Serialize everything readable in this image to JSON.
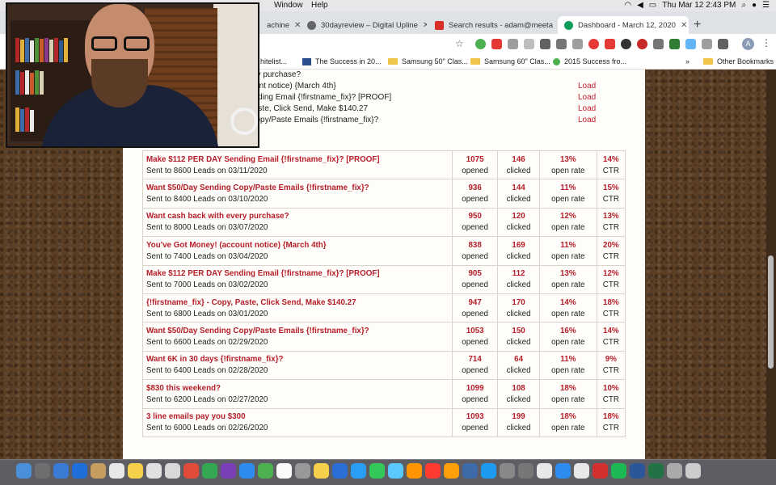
{
  "menubar": {
    "window_menu": "Window",
    "help_menu": "Help",
    "clock": "Thu Mar 12  2:43 PM"
  },
  "tabs": [
    {
      "label": "achine",
      "favicon_color": "#888888",
      "active": false
    },
    {
      "label": "30dayreview – Digital Upline",
      "favicon_color": "#666666",
      "active": false
    },
    {
      "label": "Search results - adam@meeta",
      "favicon_color": "#d93025",
      "active": false
    },
    {
      "label": "Dashboard - March 12, 2020",
      "favicon_color": "#0f9d58",
      "active": true
    }
  ],
  "bookmarks": [
    {
      "label": "hitelist...",
      "kind": "text"
    },
    {
      "label": "The Success in 20...",
      "kind": "square"
    },
    {
      "label": "Samsung 50\" Clas...",
      "kind": "folder"
    },
    {
      "label": "Samsung 60\" Clas...",
      "kind": "folder"
    },
    {
      "label": "2015 Success fro...",
      "kind": "circle"
    },
    {
      "label": "»",
      "kind": "text"
    },
    {
      "label": "Other Bookmarks",
      "kind": "folder"
    }
  ],
  "upper_list": [
    {
      "subject": "Want cash back with every purchase?",
      "action": ""
    },
    {
      "subject": "You've Got Money! (account notice) {March 4th}",
      "action": "Load"
    },
    {
      "subject": "Make $112 PER DAY Sending Email {!firstname_fix}? [PROOF]",
      "action": "Load"
    },
    {
      "subject": "{!firstname_fix} - Copy, Paste, Click Send, Make $140.27",
      "action": "Load"
    },
    {
      "subject": "Want $50/Day Sending Copy/Paste Emails {!firstname_fix}?",
      "action": "Load"
    }
  ],
  "stats_labels": {
    "opened": "opened",
    "clicked": "clicked",
    "open_rate": "open rate",
    "ctr": "CTR"
  },
  "campaigns": [
    {
      "subject": "Make $112 PER DAY Sending Email {!firstname_fix}? [PROOF]",
      "sent": "Sent to 8600 Leads on 03/11/2020",
      "opened": "1075",
      "clicked": "146",
      "open_rate": "13%",
      "ctr": "14%"
    },
    {
      "subject": "Want $50/Day Sending Copy/Paste Emails {!firstname_fix}?",
      "sent": "Sent to 8400 Leads on 03/10/2020",
      "opened": "936",
      "clicked": "144",
      "open_rate": "11%",
      "ctr": "15%"
    },
    {
      "subject": "Want cash back with every purchase?",
      "sent": "Sent to 8000 Leads on 03/07/2020",
      "opened": "950",
      "clicked": "120",
      "open_rate": "12%",
      "ctr": "13%"
    },
    {
      "subject": "You've Got Money! (account notice) {March 4th}",
      "sent": "Sent to 7400 Leads on 03/04/2020",
      "opened": "838",
      "clicked": "169",
      "open_rate": "11%",
      "ctr": "20%"
    },
    {
      "subject": "Make $112 PER DAY Sending Email {!firstname_fix}? [PROOF]",
      "sent": "Sent to 7000 Leads on 03/02/2020",
      "opened": "905",
      "clicked": "112",
      "open_rate": "13%",
      "ctr": "12%"
    },
    {
      "subject": "{!firstname_fix} - Copy, Paste, Click Send, Make $140.27",
      "sent": "Sent to 6800 Leads on 03/01/2020",
      "opened": "947",
      "clicked": "170",
      "open_rate": "14%",
      "ctr": "18%"
    },
    {
      "subject": "Want $50/Day Sending Copy/Paste Emails {!firstname_fix}?",
      "sent": "Sent to 6600 Leads on 02/29/2020",
      "opened": "1053",
      "clicked": "150",
      "open_rate": "16%",
      "ctr": "14%"
    },
    {
      "subject": "Want 6K in 30 days {!firstname_fix}?",
      "sent": "Sent to 6400 Leads on 02/28/2020",
      "opened": "714",
      "clicked": "64",
      "open_rate": "11%",
      "ctr": "9%"
    },
    {
      "subject": "$830 this weekend?",
      "sent": "Sent to 6200 Leads on 02/27/2020",
      "opened": "1099",
      "clicked": "108",
      "open_rate": "18%",
      "ctr": "10%"
    },
    {
      "subject": "3 line emails pay you $300",
      "sent": "Sent to 6000 Leads on 02/26/2020",
      "opened": "1093",
      "clicked": "199",
      "open_rate": "18%",
      "ctr": "18%"
    }
  ],
  "colors": {
    "accent_red": "#b51e2a",
    "page_bg": "#5b3e24",
    "card_bg": "#fffdf9"
  },
  "profile_initial": "A"
}
